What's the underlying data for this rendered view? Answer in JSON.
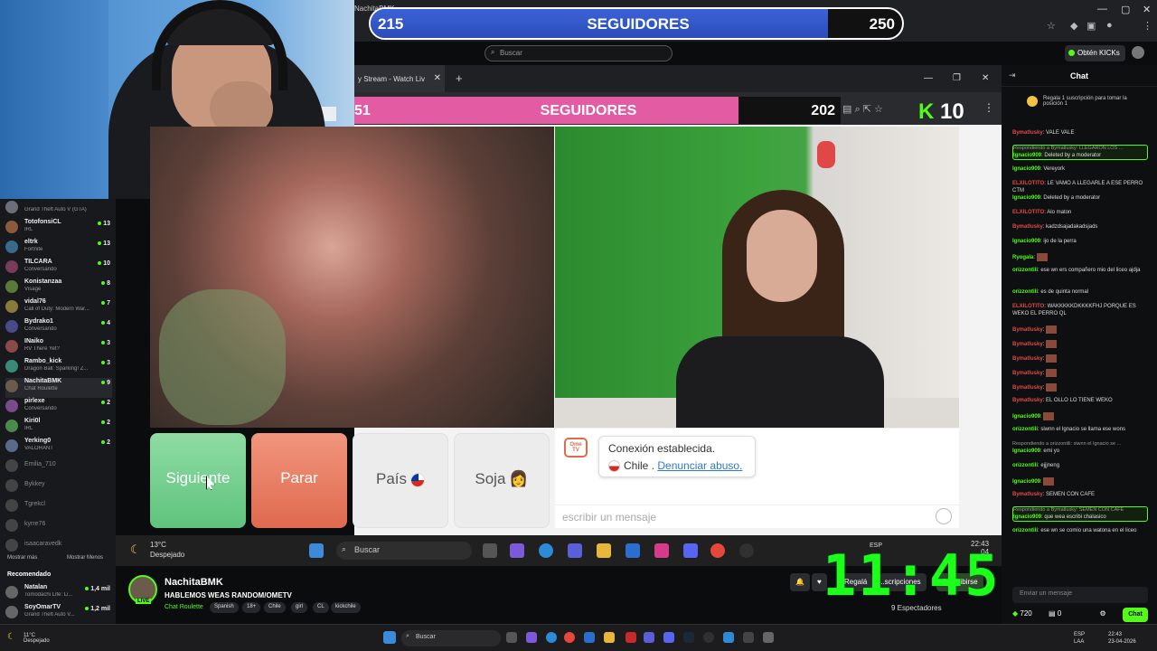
{
  "browser": {
    "tab_label": "NachitaBMK",
    "window_controls": [
      "—",
      "▢",
      "✕"
    ]
  },
  "followers_goal_top": {
    "current": "215",
    "title": "SEGUIDORES",
    "target": "250",
    "progress": 0.86
  },
  "kick": {
    "search_placeholder": "Buscar",
    "get_kicks_label": "Obtén KICKs"
  },
  "sidebar": {
    "channels": [
      {
        "name": "",
        "sub": "Grand Theft Auto V (GTA)",
        "viewers": ""
      },
      {
        "name": "TotofonsiCL",
        "sub": "IRL",
        "viewers": "13"
      },
      {
        "name": "eltrk",
        "sub": "Fortnite",
        "viewers": "13"
      },
      {
        "name": "TILCARA",
        "sub": "Conversando",
        "viewers": "10"
      },
      {
        "name": "Konistanzaa",
        "sub": "Visage",
        "viewers": "8"
      },
      {
        "name": "vidal76",
        "sub": "Call of Duty: Modern War...",
        "viewers": "7"
      },
      {
        "name": "Bydrako1",
        "sub": "Conversando",
        "viewers": "4"
      },
      {
        "name": "INaiko",
        "sub": "RV There Yet?",
        "viewers": "3"
      },
      {
        "name": "Rambo_kick",
        "sub": "Dragon Ball: Sparking! Z...",
        "viewers": "3"
      },
      {
        "name": "NachitaBMK",
        "sub": "Chat Roulette",
        "viewers": "9"
      },
      {
        "name": "pirlexe",
        "sub": "Conversando",
        "viewers": "2"
      },
      {
        "name": "Kiri0l",
        "sub": "IRL",
        "viewers": "2"
      },
      {
        "name": "Yerking0",
        "sub": "VALORANT",
        "viewers": "2"
      }
    ],
    "offline": [
      "Emilia_710",
      "Bykkey",
      "Tgrekcl",
      "kyrre76",
      "isaacaravedk"
    ],
    "show_more": "Mostrar más",
    "show_less": "Mostrar Menos",
    "recommended_title": "Recomendado",
    "recommended": [
      {
        "name": "Natalan",
        "sub": "Tomodachi Life: Li...",
        "viewers": "1,4 mil"
      },
      {
        "name": "SoyOmarTV",
        "sub": "Grand Theft Auto V...",
        "viewers": "1,2 mil"
      }
    ]
  },
  "omegle": {
    "tab_title": "y Stream - Watch Liv",
    "followers_goal": {
      "current": "51",
      "title": "SEGUIDORES",
      "target": "202",
      "progress": 0.79
    },
    "kick_counter": "10",
    "buttons": {
      "next": "Siguiente",
      "stop": "Parar",
      "country": "País",
      "soja": "Soja"
    },
    "chat": {
      "logo": "Ome TV",
      "connected": "Conexión establecida.",
      "country": "Chile .",
      "report": "Denunciar abuso.",
      "input_placeholder": "escribir un mensaje"
    }
  },
  "inner_taskbar": {
    "temp": "13°C",
    "condition": "Despejado",
    "search": "Buscar",
    "lang": "ESP",
    "time": "22:43",
    "date": "04"
  },
  "clock": "11:45:12",
  "stream_info": {
    "streamer": "NachitaBMK",
    "title": "HABLEMOS WEAS RANDOM/OMETV",
    "category": "Chat Roulette",
    "tags": [
      "Spanish",
      "18+",
      "Chile",
      "girl",
      "CL",
      "kickchile"
    ],
    "gift_label": "Regalá",
    "subscribe_label": "...scripciones",
    "follow_label": "Suscribirse",
    "viewers": "9 Espectadores",
    "live_badge": "LIVE"
  },
  "chat_panel": {
    "title": "Chat",
    "pinned": "Regala 1 suscripción para tomar la posición 1",
    "messages": [
      {
        "user": "Bymatlusky",
        "text": "VALE VALE",
        "color": "#e04848"
      },
      {
        "user": "Ignacio909",
        "text": "Deleted by a moderator",
        "color": "#53fc18",
        "reply": "Respondiendo a Bymatlusky: LLEGARON LOS ...",
        "hl": true
      },
      {
        "user": "Ignacio909",
        "text": "Vereyork",
        "color": "#53fc18"
      },
      {
        "user": "ELXILOTITO",
        "text": "LE VAMO A LLEGARLE A ESE PERRO CTM",
        "color": "#e04848"
      },
      {
        "user": "Ignacio909",
        "text": "Deleted by a moderator",
        "color": "#53fc18"
      },
      {
        "user": "ELXILOTITO",
        "text": "Alo maton",
        "color": "#e04848"
      },
      {
        "user": "Bymatlusky",
        "text": "kadzdsajadakadsjads",
        "color": "#e04848"
      },
      {
        "user": "Ignacio909",
        "text": "ijo de la perra",
        "color": "#53fc18"
      },
      {
        "user": "Ryogala",
        "text": "",
        "color": "#53fc18"
      },
      {
        "user": "orizzontili",
        "text": "ese wn ers compañero mio del liceo ajdja",
        "color": "#53fc18"
      },
      {
        "user": "orizzontili",
        "text": "es de quinta normal",
        "color": "#53fc18"
      },
      {
        "user": "ELXILOTITO",
        "text": "WAKKKKKDKKKKFHJ PORQUE ES WEKO EL PERRO QL",
        "color": "#e04848"
      },
      {
        "user": "Bymatlusky",
        "text": "",
        "color": "#e04848"
      },
      {
        "user": "Bymatlusky",
        "text": "",
        "color": "#e04848"
      },
      {
        "user": "Bymatlusky",
        "text": "",
        "color": "#e04848"
      },
      {
        "user": "Bymatlusky",
        "text": "",
        "color": "#e04848"
      },
      {
        "user": "Bymatlusky",
        "text": "",
        "color": "#e04848"
      },
      {
        "user": "Bymatlusky",
        "text": "EL OLLO LO TIENE WEKO",
        "color": "#e04848"
      },
      {
        "user": "Ignacio909",
        "text": "",
        "color": "#53fc18"
      },
      {
        "user": "orizzontili",
        "text": "siwnn el Ignacio se llama ese wons",
        "color": "#53fc18"
      },
      {
        "user": "Ignacio909",
        "text": "emi yo",
        "color": "#53fc18",
        "reply": "Respondiendo a orizzontili: siwnn el Ignacio se ..."
      },
      {
        "user": "orizzontili",
        "text": "ejjjneng",
        "color": "#53fc18"
      },
      {
        "user": "Ignacio909",
        "text": "",
        "color": "#53fc18"
      },
      {
        "user": "Bymatlusky",
        "text": "SEMEN CON CAFE",
        "color": "#e04848"
      },
      {
        "user": "Ignacio909",
        "text": "que wea escribi chalasico",
        "color": "#53fc18",
        "reply": "Respondiendo a Bymatlusky: SEMEN CON CAFE",
        "hl": true
      },
      {
        "user": "orizzontili",
        "text": "ese wn se comio una watona en el liceo",
        "color": "#53fc18"
      }
    ],
    "input_placeholder": "Enviar un mensaje",
    "kicks": "720",
    "counter": "0",
    "chat_button": "Chat"
  },
  "outer_taskbar": {
    "temp": "11°C",
    "condition": "Despejado",
    "search": "Buscar",
    "lang_top": "ESP",
    "lang_bottom": "LAA",
    "time": "22:43",
    "date": "23-04-2026"
  }
}
